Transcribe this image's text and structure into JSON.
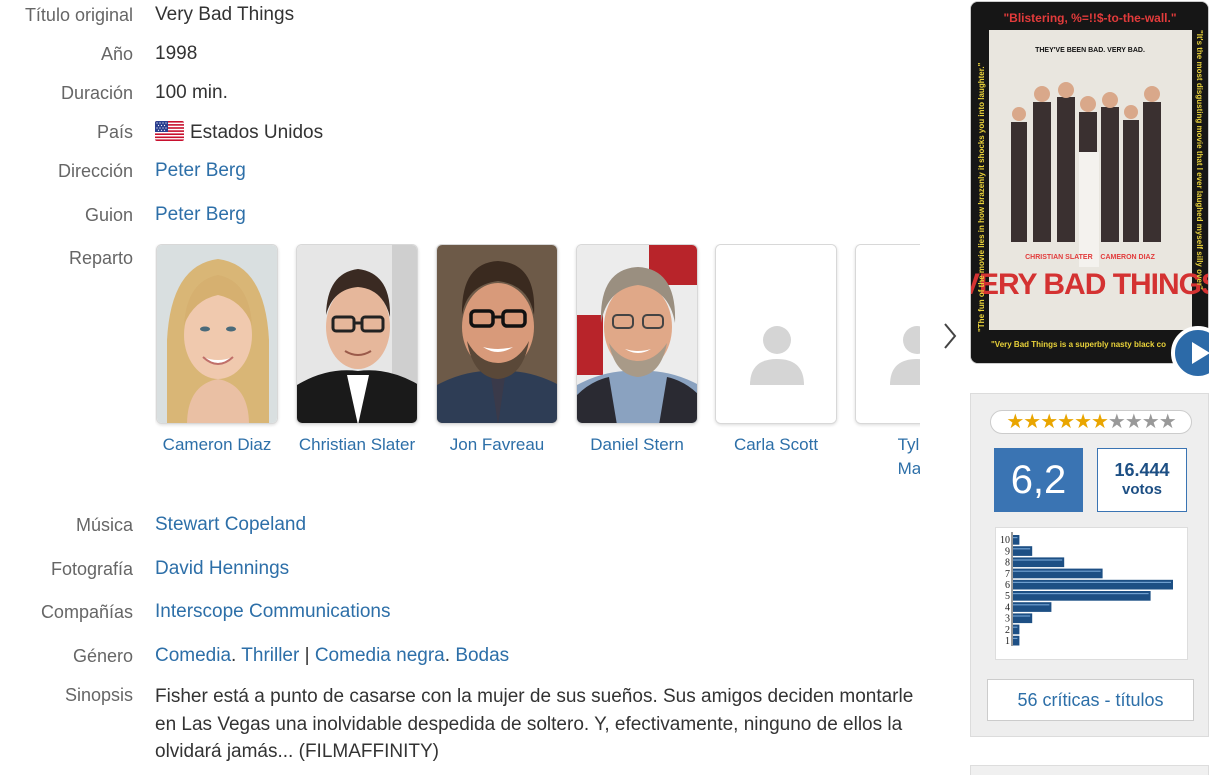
{
  "fields": {
    "titulo_original": {
      "label": "Título original",
      "value": "Very Bad Things"
    },
    "anio": {
      "label": "Año",
      "value": "1998"
    },
    "duracion": {
      "label": "Duración",
      "value": "100 min."
    },
    "pais": {
      "label": "País",
      "value": "Estados Unidos",
      "flag_icon": "us-flag-icon"
    },
    "direccion": {
      "label": "Dirección",
      "value": "Peter Berg"
    },
    "guion": {
      "label": "Guion",
      "value": "Peter Berg"
    },
    "reparto": {
      "label": "Reparto"
    },
    "musica": {
      "label": "Música",
      "value": "Stewart Copeland"
    },
    "fotografia": {
      "label": "Fotografía",
      "value": "David Hennings"
    },
    "companias": {
      "label": "Compañías",
      "value": "Interscope Communications"
    },
    "genero": {
      "label": "Género",
      "items": [
        "Comedia",
        "Thriller",
        "Comedia negra",
        "Bodas"
      ],
      "sep1": ".",
      "sep2": "|",
      "sep3": "."
    },
    "sinopsis": {
      "label": "Sinopsis",
      "value": "Fisher está a punto de casarse con la mujer de sus sueños. Sus amigos deciden montarle en Las Vegas una inolvidable despedida de soltero. Y, efectivamente, ninguno de ellos la olvidará jamás... (FILMAFFINITY)"
    }
  },
  "cast": [
    {
      "name": "Cameron Diaz",
      "has_photo": true
    },
    {
      "name": "Christian Slater",
      "has_photo": true
    },
    {
      "name": "Jon Favreau",
      "has_photo": true
    },
    {
      "name": "Daniel Stern",
      "has_photo": true
    },
    {
      "name": "Carla Scott",
      "has_photo": false
    },
    {
      "name": "Tyler Malinger",
      "visible_text": "Tyler\nMalir",
      "has_photo": false
    }
  ],
  "poster": {
    "quote_top": "\"Blistering, %=!!$-to-the-wall.\"",
    "title_art": "VERY BAD THINGS",
    "tagline": "THEY'VE BEEN BAD. VERY BAD.",
    "side_left": "\"The fun of the movie lies in how brazenly it shocks you into laughter.\"",
    "side_right": "\"It's the most disgusting movie that I ever laughed myself silly over\"",
    "quote_bottom": "\"Very Bad Things is a superbly nasty black co",
    "stars_line": "CHRISTIAN SLATER    CAMERON DIAZ"
  },
  "rating": {
    "stars_filled": 6,
    "stars_total": 10,
    "score": "6,2",
    "votes_count": "16.444",
    "votes_label": "votos",
    "critics_label": "56 críticas - títulos"
  },
  "chart_data": {
    "type": "bar",
    "orientation": "horizontal",
    "categories": [
      "10",
      "9",
      "8",
      "7",
      "6",
      "5",
      "4",
      "3",
      "2",
      "1"
    ],
    "values": [
      2,
      6,
      16,
      28,
      50,
      43,
      12,
      6,
      2,
      2
    ],
    "xlabel": "",
    "ylabel": "",
    "grid": false,
    "colors": {
      "bar": "#1d4f84"
    }
  },
  "colors": {
    "link": "#2d6fa8",
    "score_bg": "#3a74b3",
    "label": "#666666",
    "star_on": "#e9a500"
  }
}
